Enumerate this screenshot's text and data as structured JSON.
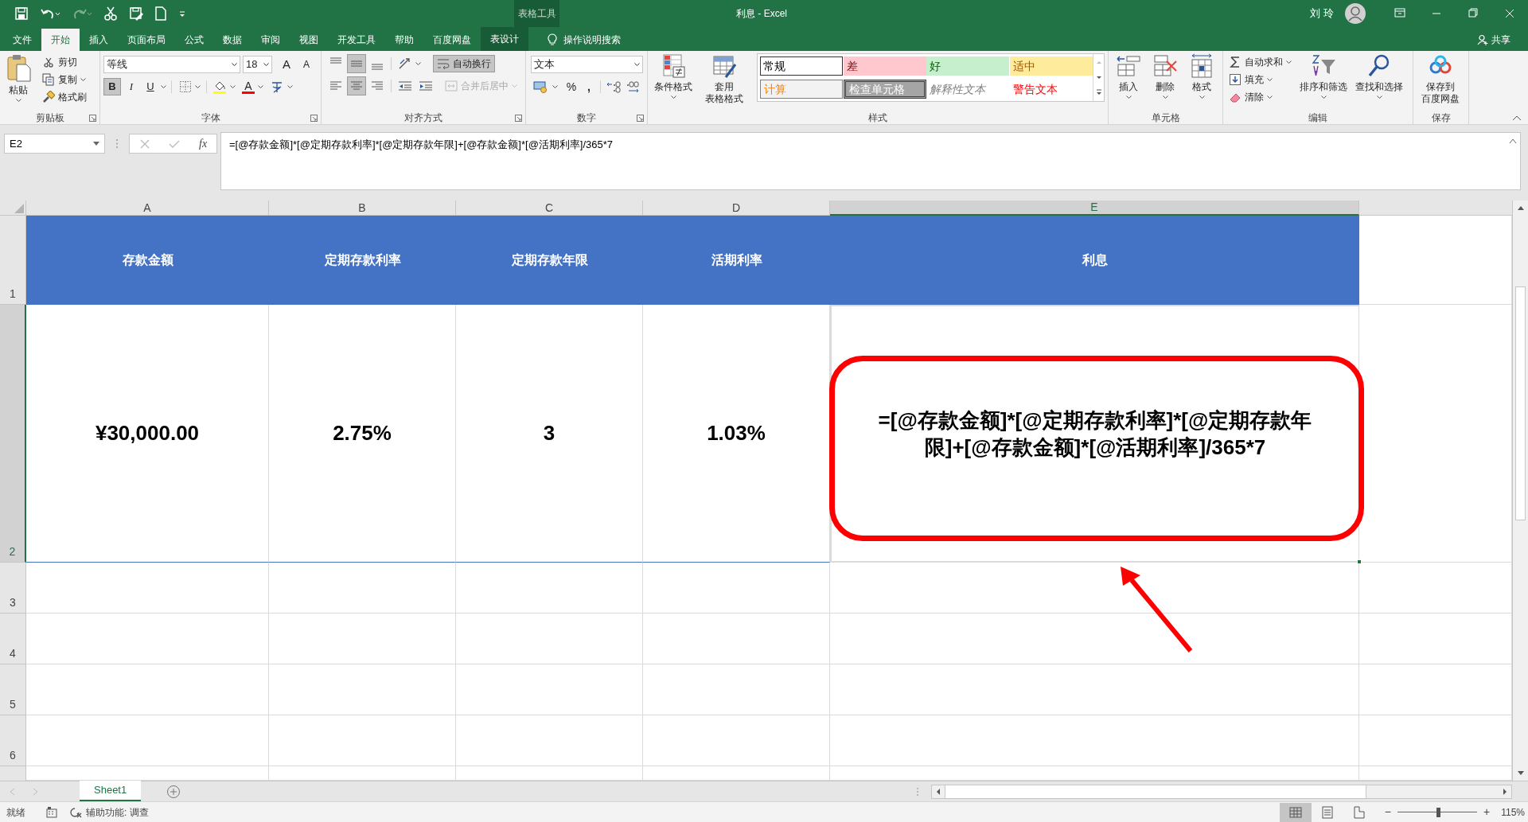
{
  "title_bar": {
    "title": "利息 - Excel",
    "context_label": "表格工具",
    "user": "刘 玲"
  },
  "tabs": [
    {
      "label": "文件",
      "selected": false,
      "kind": "normal"
    },
    {
      "label": "开始",
      "selected": true,
      "kind": "normal"
    },
    {
      "label": "插入",
      "selected": false,
      "kind": "normal"
    },
    {
      "label": "页面布局",
      "selected": false,
      "kind": "normal"
    },
    {
      "label": "公式",
      "selected": false,
      "kind": "normal"
    },
    {
      "label": "数据",
      "selected": false,
      "kind": "normal"
    },
    {
      "label": "审阅",
      "selected": false,
      "kind": "normal"
    },
    {
      "label": "视图",
      "selected": false,
      "kind": "normal"
    },
    {
      "label": "开发工具",
      "selected": false,
      "kind": "normal"
    },
    {
      "label": "帮助",
      "selected": false,
      "kind": "normal"
    },
    {
      "label": "百度网盘",
      "selected": false,
      "kind": "normal"
    },
    {
      "label": "表设计",
      "selected": false,
      "kind": "contextual"
    }
  ],
  "tell_me": "操作说明搜索",
  "share": "共享",
  "ribbon": [
    {
      "kind": "clipboard",
      "label": "剪贴板",
      "paste": "粘贴",
      "items": [
        {
          "kind": "cut",
          "label": "剪切"
        },
        {
          "kind": "copy",
          "label": "复制"
        },
        {
          "kind": "painter",
          "label": "格式刷"
        }
      ]
    },
    {
      "kind": "font",
      "label": "字体",
      "font_name": "等线",
      "font_size": "18",
      "grow": "A",
      "shrink": "A",
      "styles": [
        {
          "label": "B",
          "selected": true
        },
        {
          "label": "I",
          "selected": false
        },
        {
          "label": "U",
          "selected": false
        }
      ],
      "font_color": "A"
    },
    {
      "kind": "alignment",
      "label": "对齐方式",
      "vertical": [
        {
          "selected": false
        },
        {
          "selected": true
        },
        {
          "selected": false
        }
      ],
      "horizontal": [
        {
          "selected": false
        },
        {
          "selected": true
        },
        {
          "selected": false
        }
      ],
      "wrap": {
        "label": "自动换行",
        "on": true
      },
      "merge": {
        "label": "合并后居中",
        "disabled": true
      }
    },
    {
      "kind": "number",
      "label": "数字",
      "format": "文本",
      "percent": "%",
      "comma": ","
    },
    {
      "kind": "styles",
      "label": "样式",
      "conditional": [
        "条件格式"
      ],
      "table_format": [
        "套用",
        "表格格式"
      ],
      "cell_styles": [
        {
          "label": "常规",
          "kind": "normal",
          "selected": true
        },
        {
          "label": "差",
          "kind": "bad",
          "selected": false
        },
        {
          "label": "好",
          "kind": "good",
          "selected": false
        },
        {
          "label": "适中",
          "kind": "neutral",
          "selected": false
        },
        {
          "label": "计算",
          "kind": "calc",
          "selected": false
        },
        {
          "label": "检查单元格",
          "kind": "check",
          "selected": false
        },
        {
          "label": "解释性文本",
          "kind": "explanatory",
          "selected": false
        },
        {
          "label": "警告文本",
          "kind": "warning",
          "selected": false
        }
      ]
    },
    {
      "kind": "cells",
      "label": "单元格",
      "buttons": [
        {
          "kind": "insert",
          "label": "插入"
        },
        {
          "kind": "delete",
          "label": "删除"
        },
        {
          "kind": "format",
          "label": "格式"
        }
      ]
    },
    {
      "kind": "editing",
      "label": "编辑",
      "small": [
        {
          "kind": "sum",
          "label": "自动求和"
        },
        {
          "kind": "fill",
          "label": "填充"
        },
        {
          "kind": "clear",
          "label": "清除"
        }
      ],
      "large": [
        {
          "kind": "sort",
          "label": "排序和筛选"
        },
        {
          "kind": "find",
          "label": "查找和选择"
        }
      ]
    },
    {
      "kind": "save",
      "label": "保存",
      "button": [
        "保存到",
        "百度网盘"
      ]
    }
  ],
  "formula_bar": {
    "name_box": "E2",
    "fx": "fx",
    "formula": "=[@存款金额]*[@定期存款利率]*[@定期存款年限]+[@存款金额]*[@活期利率]/365*7"
  },
  "sheet": {
    "columns": [
      {
        "label": "A",
        "selected": false
      },
      {
        "label": "B",
        "selected": false
      },
      {
        "label": "C",
        "selected": false
      },
      {
        "label": "D",
        "selected": false
      },
      {
        "label": "E",
        "selected": true
      }
    ],
    "rows": [
      {
        "label": "1",
        "selected": false
      },
      {
        "label": "2",
        "selected": true
      },
      {
        "label": "3",
        "selected": false
      },
      {
        "label": "4",
        "selected": false
      },
      {
        "label": "5",
        "selected": false
      },
      {
        "label": "6",
        "selected": false
      }
    ],
    "table": {
      "header": [
        "存款金额",
        "定期存款利率",
        "定期存款年限",
        "活期利率",
        "利息"
      ],
      "values": [
        {
          "text": "¥30,000.00",
          "selected": false
        },
        {
          "text": "2.75%",
          "selected": false
        },
        {
          "text": "3",
          "selected": false
        },
        {
          "text": "1.03%",
          "selected": false
        },
        {
          "text": "=[@存款金额]*[@定期存款利率]*[@定期存款年限]+[@存款金额]*[@活期利率]/365*7",
          "selected": true
        }
      ]
    }
  },
  "sheet_tabs": [
    {
      "label": "Sheet1",
      "selected": true
    }
  ],
  "status_bar": {
    "ready": "就绪",
    "accessibility": "辅助功能: 调查",
    "views": [
      {
        "kind": "normal",
        "selected": true
      },
      {
        "kind": "page_layout",
        "selected": false
      },
      {
        "kind": "page_break",
        "selected": false
      }
    ],
    "zoom_out": "−",
    "zoom_in": "+",
    "zoom": {
      "level": 0.51
    },
    "zoom_label": "115%"
  }
}
